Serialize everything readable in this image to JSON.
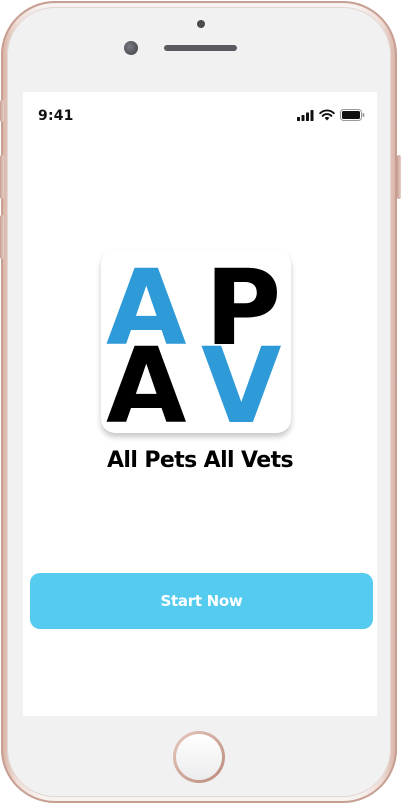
{
  "status_bar": {
    "time": "9:41",
    "icons": [
      "signal-icon",
      "wifi-icon",
      "battery-icon"
    ]
  },
  "logo": {
    "letters": [
      "A",
      "P",
      "A",
      "V"
    ],
    "colors": {
      "blue": "#2e9ad8",
      "black": "#000000"
    }
  },
  "app": {
    "name": "All Pets All Vets"
  },
  "actions": {
    "start_label": "Start Now",
    "start_color": "#55cbf0"
  }
}
